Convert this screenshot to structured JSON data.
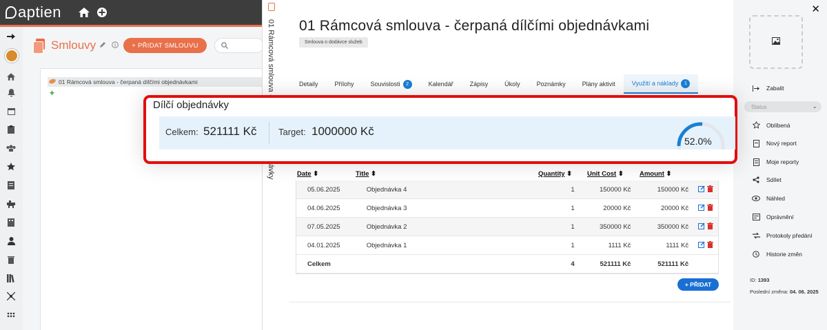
{
  "app": {
    "logo_text": "aptien"
  },
  "list": {
    "title": "Smlouvy",
    "add_button": "+ PŘIDAT SMLOUVU",
    "tree_item": "01 Rámcová smlouva - čerpaná dílčími objednávkami",
    "add_symbol": "+"
  },
  "vertical": {
    "text": "01 Rámcová smlouva - če",
    "text2": "ávky"
  },
  "detail": {
    "title": "01 Rámcová smlouva - čerpaná dílčími objednávkami",
    "badge": "Smlouva o dodávce služeb",
    "tabs": [
      {
        "label": "Detaily",
        "count": null
      },
      {
        "label": "Přílohy",
        "count": null
      },
      {
        "label": "Souvislosti",
        "count": "2"
      },
      {
        "label": "Kalendář",
        "count": null
      },
      {
        "label": "Zápisy",
        "count": null
      },
      {
        "label": "Úkoly",
        "count": null
      },
      {
        "label": "Poznámky",
        "count": null
      },
      {
        "label": "Plány aktivit",
        "count": null
      },
      {
        "label": "Využití a náklady",
        "count": "1"
      }
    ]
  },
  "summary": {
    "title": "Dílčí objednávky",
    "total_label": "Celkem:",
    "total_value": "521111 Kč",
    "target_label": "Target:",
    "target_value": "1000000 Kč",
    "percent": 0.52,
    "percent_text": "52.0%",
    "accent": "#1a7fd4"
  },
  "table": {
    "headers": {
      "date": "Date",
      "title": "Title",
      "quantity": "Quantity",
      "unit_cost": "Unit Cost",
      "amount": "Amount"
    },
    "rows": [
      {
        "date": "05.06.2025",
        "title": "Objednávka 4",
        "quantity": "1",
        "unit_cost": "150000 Kč",
        "amount": "150000 Kč"
      },
      {
        "date": "04.06.2025",
        "title": "Objednávka 3",
        "quantity": "1",
        "unit_cost": "20000 Kč",
        "amount": "20000 Kč"
      },
      {
        "date": "07.05.2025",
        "title": "Objednávka 2",
        "quantity": "1",
        "unit_cost": "350000 Kč",
        "amount": "350000 Kč"
      },
      {
        "date": "04.01.2025",
        "title": "Objednávka 1",
        "quantity": "1",
        "unit_cost": "1111 Kč",
        "amount": "1111 Kč"
      }
    ],
    "total": {
      "label": "Celkem",
      "quantity": "4",
      "unit_cost": "521111 Kč",
      "amount": "521111 Kč"
    },
    "add_button": "+ PŘIDAT"
  },
  "right": {
    "collapse": "Zabalit",
    "status_placeholder": "Status",
    "items": [
      "Oblíbená",
      "Nový report",
      "Moje reporty",
      "Sdílet",
      "Náhled",
      "Oprávnění",
      "Protokoly předání",
      "Historie změn"
    ],
    "id_label": "ID:",
    "id_value": "1393",
    "last_change_label": "Poslední změna:",
    "last_change_value": "04. 06. 2025"
  },
  "colors": {
    "brand": "#e8704a",
    "primary": "#1a7fd4",
    "highlight": "#e30d0d",
    "delete": "#d9302c"
  }
}
